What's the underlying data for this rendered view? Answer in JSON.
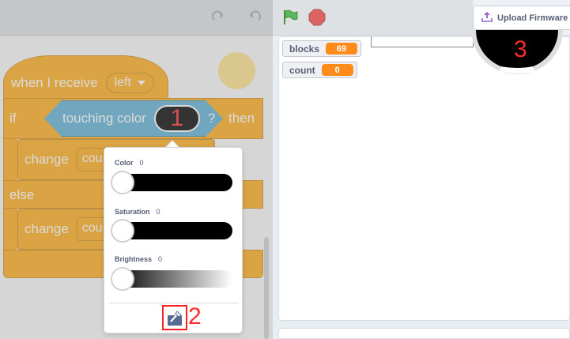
{
  "toolbar": {
    "upload_label": "Upload Firmware",
    "icons": [
      "redo-icon",
      "undo-icon",
      "green-flag-icon",
      "stop-icon",
      "upload-icon"
    ]
  },
  "code": {
    "hat_label": "when I receive",
    "hat_value": "left",
    "if_label": "if",
    "sensing_label": "touching color",
    "sensing_q": "?",
    "then_label": "then",
    "else_label": "else",
    "change_label": "change",
    "change_var_1": "cou",
    "change_var_2": "cou"
  },
  "picker": {
    "color_label": "Color",
    "color_value": "0",
    "saturation_label": "Saturation",
    "saturation_value": "0",
    "brightness_label": "Brightness",
    "brightness_value": "0",
    "tool_icon": "eyedropper-icon"
  },
  "stage": {
    "monitors": [
      {
        "name": "blocks",
        "value": "69"
      },
      {
        "name": "count",
        "value": "0"
      }
    ]
  },
  "annotations": {
    "one": "1",
    "two": "2",
    "three": "3"
  },
  "colors": {
    "events_orange": "#ffab19",
    "sensing_blue": "#5cb1d6",
    "monitor_orange": "#ff8c1a",
    "annotation_red": "#ff2b2b"
  }
}
